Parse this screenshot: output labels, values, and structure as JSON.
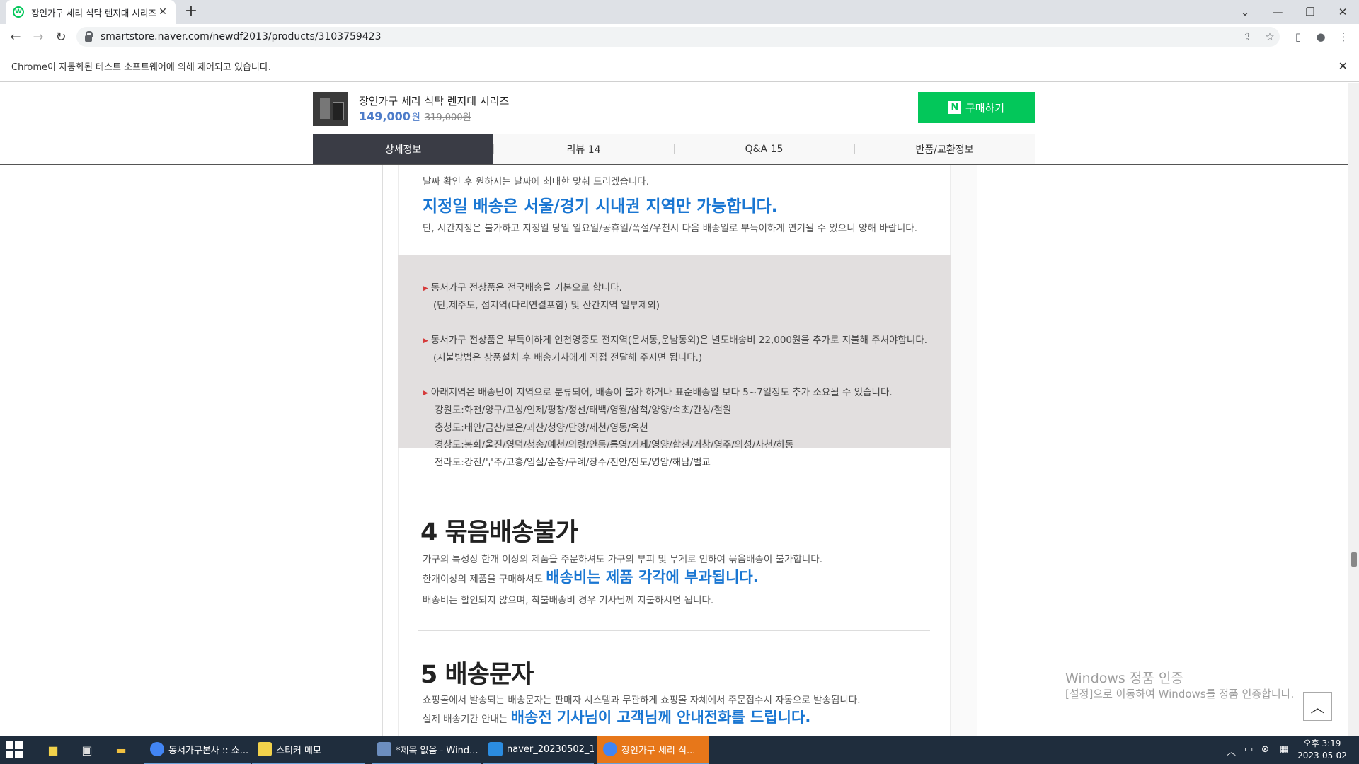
{
  "browser": {
    "tab_title": "장인가구 세리 식탁 렌지대 시리즈",
    "tab_favicon_letter": "W",
    "new_tab_glyph": "+",
    "address": "smartstore.naver.com/newdf2013/products/3103759423",
    "infobar_text": "Chrome이 자동화된 테스트 소프트웨어에 의해 제어되고 있습니다.",
    "icons": [
      "tab-search-icon",
      "minimize-icon",
      "maximize-icon",
      "close-icon",
      "back-icon",
      "forward-icon",
      "reload-icon",
      "lock-icon",
      "share-icon",
      "bookmark-star-icon",
      "side-panel-icon",
      "profile-icon",
      "menu-icon"
    ]
  },
  "product": {
    "name": "장인가구 세리 식탁 렌지대 시리즈",
    "price": "149,000",
    "price_unit": "원",
    "original_price": "319,000원",
    "buy_label": "구매하기",
    "buy_logo": "N",
    "tabs": [
      {
        "label": "상세정보",
        "active": true
      },
      {
        "label": "리뷰 14",
        "active": false
      },
      {
        "label": "Q&A 15",
        "active": false
      },
      {
        "label": "반품/교환정보",
        "active": false
      }
    ]
  },
  "content": {
    "top_line": "날짜 확인 후 원하시는 날짜에 최대한 맞춰 드리겠습니다.",
    "designated_headline": "지정일 배송은 서울/경기 시내권 지역만 가능합니다.",
    "designated_note": "단, 시간지정은 불가하고 지정일 당일 일요일/공휴일/폭설/우천시 다음 배송일로 부득이하게 연기될 수 있으니 양해 바랍니다.",
    "notice": {
      "b1_line1": "동서가구 전상품은 전국배송을 기본으로 합니다.",
      "b1_line2": "(단,제주도, 섬지역(다리연결포함) 및 산간지역 일부제외)",
      "b2_line1": "동서가구 전상품은 부득이하게 인천영종도 전지역(운서동,운남동외)은 별도배송비 22,000원을 추가로 지불해 주셔야합니다.",
      "b2_line2": "(지불방법은 상품설치 후 배송기사에게 직접 전달해 주시면 됩니다.)",
      "b3_line1": "아래지역은 배송난이 지역으로 분류되어, 배송이 불가 하거나 표준배송일 보다 5~7일정도 추가 소요될 수 있습니다.",
      "regions": [
        "강원도:화천/양구/고성/인제/평창/정선/태백/영월/삼척/양양/속초/간성/철원",
        "충청도:태안/금산/보은/괴산/청양/단양/제천/영동/옥천",
        "경상도:봉화/울진/영덕/청송/예천/의령/안동/통영/거제/영양/합천/거창/영주/의성/사천/하동",
        "전라도:강진/무주/고흥/임실/순창/구례/장수/진안/진도/영암/해남/벌교"
      ]
    },
    "sec4": {
      "title": "4 묶음배송불가",
      "line1": "가구의 특성상 한개 이상의 제품을 주문하셔도 가구의 부피 및 무게로 인하여 묶음배송이 불가합니다.",
      "line2_prefix": "한개이상의 제품을 구매하셔도",
      "line2_highlight": "배송비는 제품 각각에 부과됩니다.",
      "line3": "배송비는 할인되지 않으며, 착불배송비 경우 기사님께 지불하시면 됩니다."
    },
    "sec5": {
      "title": "5 배송문자",
      "line1": "쇼핑몰에서 발송되는 배송문자는 판매자 시스템과 무관하게 쇼핑몰 자체에서 주문접수시 자동으로 발송됩니다.",
      "line2_prefix": "실제 배송기간 안내는",
      "line2_highlight": "배송전 기사님이 고객님께 안내전화를 드립니다."
    }
  },
  "overlay": {
    "watermark_title": "Windows 정품 인증",
    "watermark_sub": "[설정]으로 이동하여 Windows를 정품 인증합니다.",
    "scroll_top_glyph": "︿"
  },
  "taskbar": {
    "items": [
      {
        "label": "동서가구본사 :: 쇼...",
        "color": "#4285f4",
        "active": false
      },
      {
        "label": "스티커 메모",
        "color": "#f2d24b",
        "active": false
      },
      {
        "label": "*제목 없음 - Wind...",
        "color": "#6c8ebf",
        "active": false
      },
      {
        "label": "naver_20230502_1...",
        "color": "#2b8ce0",
        "active": false
      },
      {
        "label": "장인가구 세리 식...",
        "color": "#4285f4",
        "active": true
      }
    ],
    "time": "오후 3:19",
    "date": "2023-05-02"
  }
}
